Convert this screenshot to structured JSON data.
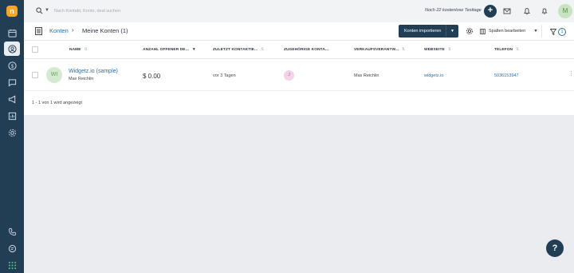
{
  "app": {
    "logo_letter": "n"
  },
  "sidebar": {
    "items": [
      {
        "name": "calendar-icon"
      },
      {
        "name": "contacts-icon",
        "active": true
      },
      {
        "name": "dollar-icon"
      },
      {
        "name": "chat-icon"
      },
      {
        "name": "megaphone-icon"
      },
      {
        "name": "reports-icon"
      },
      {
        "name": "settings-icon"
      }
    ],
    "bottom_items": [
      {
        "name": "phone-icon"
      },
      {
        "name": "support-chat-icon"
      },
      {
        "name": "apps-grid-icon"
      }
    ]
  },
  "topbar": {
    "search_placeholder": "Nach Kontakt, Konto, deal suchen",
    "trial_text": "Noch 22 kostenlose Testtage",
    "avatar_letter": "M",
    "accent": "#213e54"
  },
  "toolbar": {
    "crumb_link": "Konten",
    "crumb_sep": "›",
    "crumb_current": "Meine Konten (1)",
    "import_label": "Konten importieren",
    "columns_label": "Spalten bearbeiten",
    "filter_count": "1"
  },
  "table": {
    "headers": {
      "name": "NAME",
      "open_deals": "ANZAHL OFFENER DE...",
      "last_contacted": "ZULETZT KONTAKTIE...",
      "contacts": "ZUGEHÖRIGE KONTA...",
      "owner": "VERKAUFSVERANTW...",
      "website": "WEBSEITE",
      "phone": "TELEFON"
    },
    "rows": [
      {
        "initials": "WI",
        "name": "Widgetz.io (sample)",
        "sub": "Max Reichlin",
        "amount": "$ 0.00",
        "last_contacted": "vor 3 Tagen",
        "contact_badge": "J",
        "owner": "Max Reichlin",
        "website": "widgetz.io",
        "phone": "5036153947"
      }
    ],
    "count_text": "1 - 1 von 1 wird angezeigt"
  },
  "help": {
    "label": "?"
  }
}
